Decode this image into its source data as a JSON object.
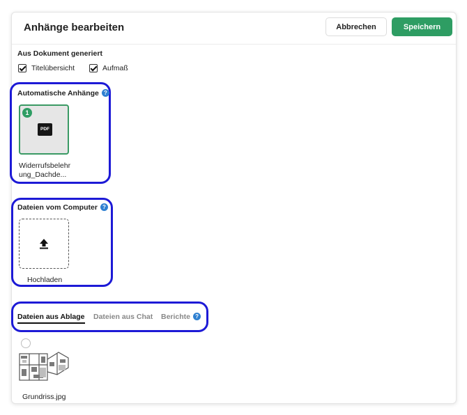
{
  "header": {
    "title": "Anhänge bearbeiten",
    "cancel_label": "Abbrechen",
    "save_label": "Speichern"
  },
  "generated": {
    "label": "Aus Dokument generiert",
    "options": [
      {
        "label": "Titelübersicht",
        "checked": true
      },
      {
        "label": "Aufmaß",
        "checked": true
      }
    ]
  },
  "auto_attachments": {
    "label": "Automatische Anhänge",
    "help_icon": "help-icon",
    "file": {
      "badge": "1",
      "icon_text": "PDF",
      "name_line1": "Widerrufsbelehr",
      "name_line2": "ung_Dachde..."
    }
  },
  "computer_files": {
    "label": "Dateien vom Computer",
    "help_icon": "help-icon",
    "upload_label": "Hochladen",
    "upload_icon": "upload-icon"
  },
  "tabs": {
    "items": [
      {
        "label": "Dateien aus Ablage",
        "active": true
      },
      {
        "label": "Dateien aus Chat",
        "active": false
      },
      {
        "label": "Berichte",
        "active": false
      }
    ],
    "help_icon": "help-icon"
  },
  "storage_files": [
    {
      "name": "Grundriss.jpg",
      "selected": false
    }
  ],
  "colors": {
    "accent_green": "#2e9d63",
    "outline_blue": "#1d1ad6",
    "help_blue": "#2f80d1"
  }
}
